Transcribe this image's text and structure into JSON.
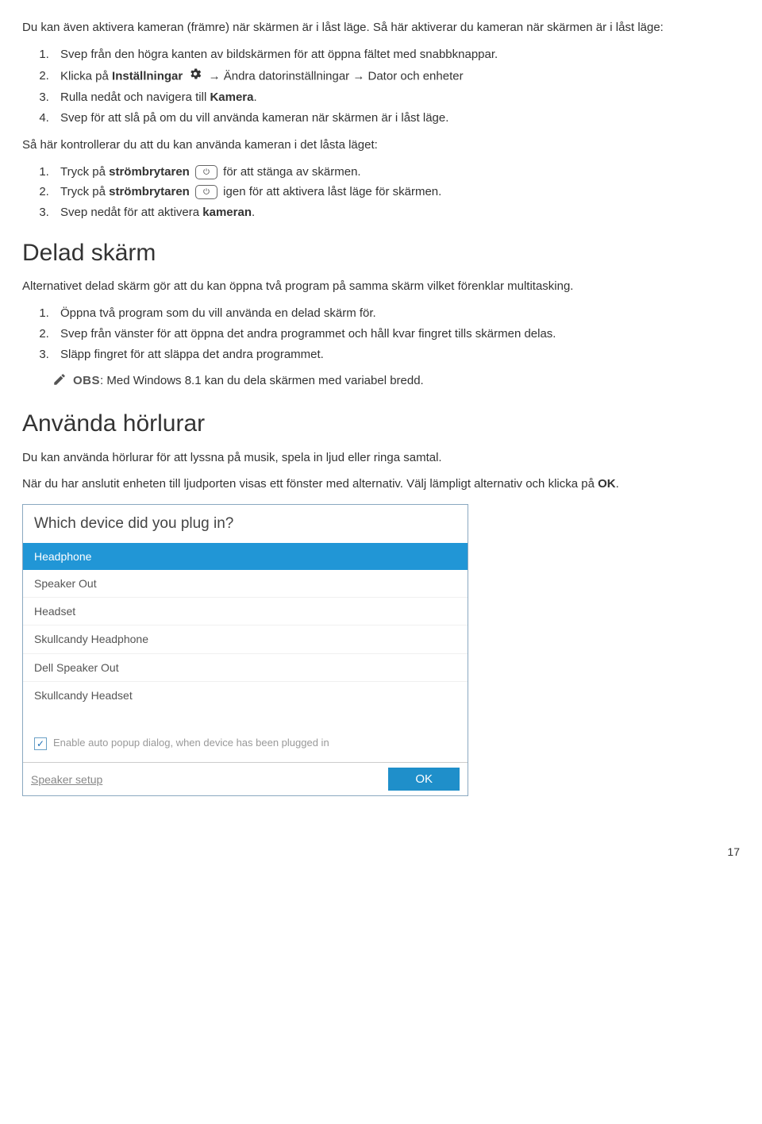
{
  "intro": {
    "p1": "Du kan även aktivera kameran (främre) när skärmen är i låst läge. Så här aktiverar du kameran när skärmen är i låst läge:"
  },
  "list1": {
    "i1": "Svep från den högra kanten av bildskärmen för att öppna fältet med snabbknappar.",
    "i2a": "Klicka på ",
    "i2b": "Inställningar",
    "i2c": " → Ändra datorinställningar → Dator och enheter",
    "i3a": "Rulla nedåt och navigera till ",
    "i3b": "Kamera",
    "i3c": ".",
    "i4": "Svep för att slå på om du vill använda kameran när skärmen är i låst läge."
  },
  "p2": "Så här kontrollerar du att du kan använda kameran i det låsta läget:",
  "list2": {
    "i1a": "Tryck på ",
    "i1b": "strömbrytaren",
    "i1c": " för att stänga av skärmen.",
    "i2a": "Tryck på ",
    "i2b": "strömbrytaren",
    "i2c": " igen för att aktivera låst läge för skärmen.",
    "i3a": "Svep nedåt för att aktivera ",
    "i3b": "kameran",
    "i3c": "."
  },
  "h_delad": "Delad skärm",
  "delad_p": "Alternativet delad skärm gör att du kan öppna två program på samma skärm vilket förenklar multitasking.",
  "list3": {
    "i1": "Öppna två program som du vill använda en delad skärm för.",
    "i2": "Svep från vänster för att öppna det andra programmet och håll kvar fingret tills skärmen delas.",
    "i3": "Släpp fingret för att släppa det andra programmet."
  },
  "note": {
    "label": "OBS",
    "text": ": Med Windows 8.1 kan du dela skärmen med variabel bredd."
  },
  "h_horlurar": "Använda hörlurar",
  "horlurar_p1": "Du kan använda hörlurar för att lyssna på musik, spela in ljud eller ringa samtal.",
  "horlurar_p2a": "När du har anslutit enheten till ljudporten visas ett fönster med alternativ. Välj lämpligt alternativ och klicka på ",
  "horlurar_p2b": "OK",
  "horlurar_p2c": ".",
  "dialog": {
    "title": "Which device did you plug in?",
    "items": [
      "Headphone",
      "Speaker Out",
      "Headset",
      "Skullcandy Headphone",
      "Dell Speaker Out",
      "Skullcandy Headset"
    ],
    "selectedIndex": 0,
    "chk_label": "Enable auto popup dialog, when device has been plugged in",
    "speaker_setup": "Speaker setup",
    "ok": "OK"
  },
  "page_number": "17"
}
